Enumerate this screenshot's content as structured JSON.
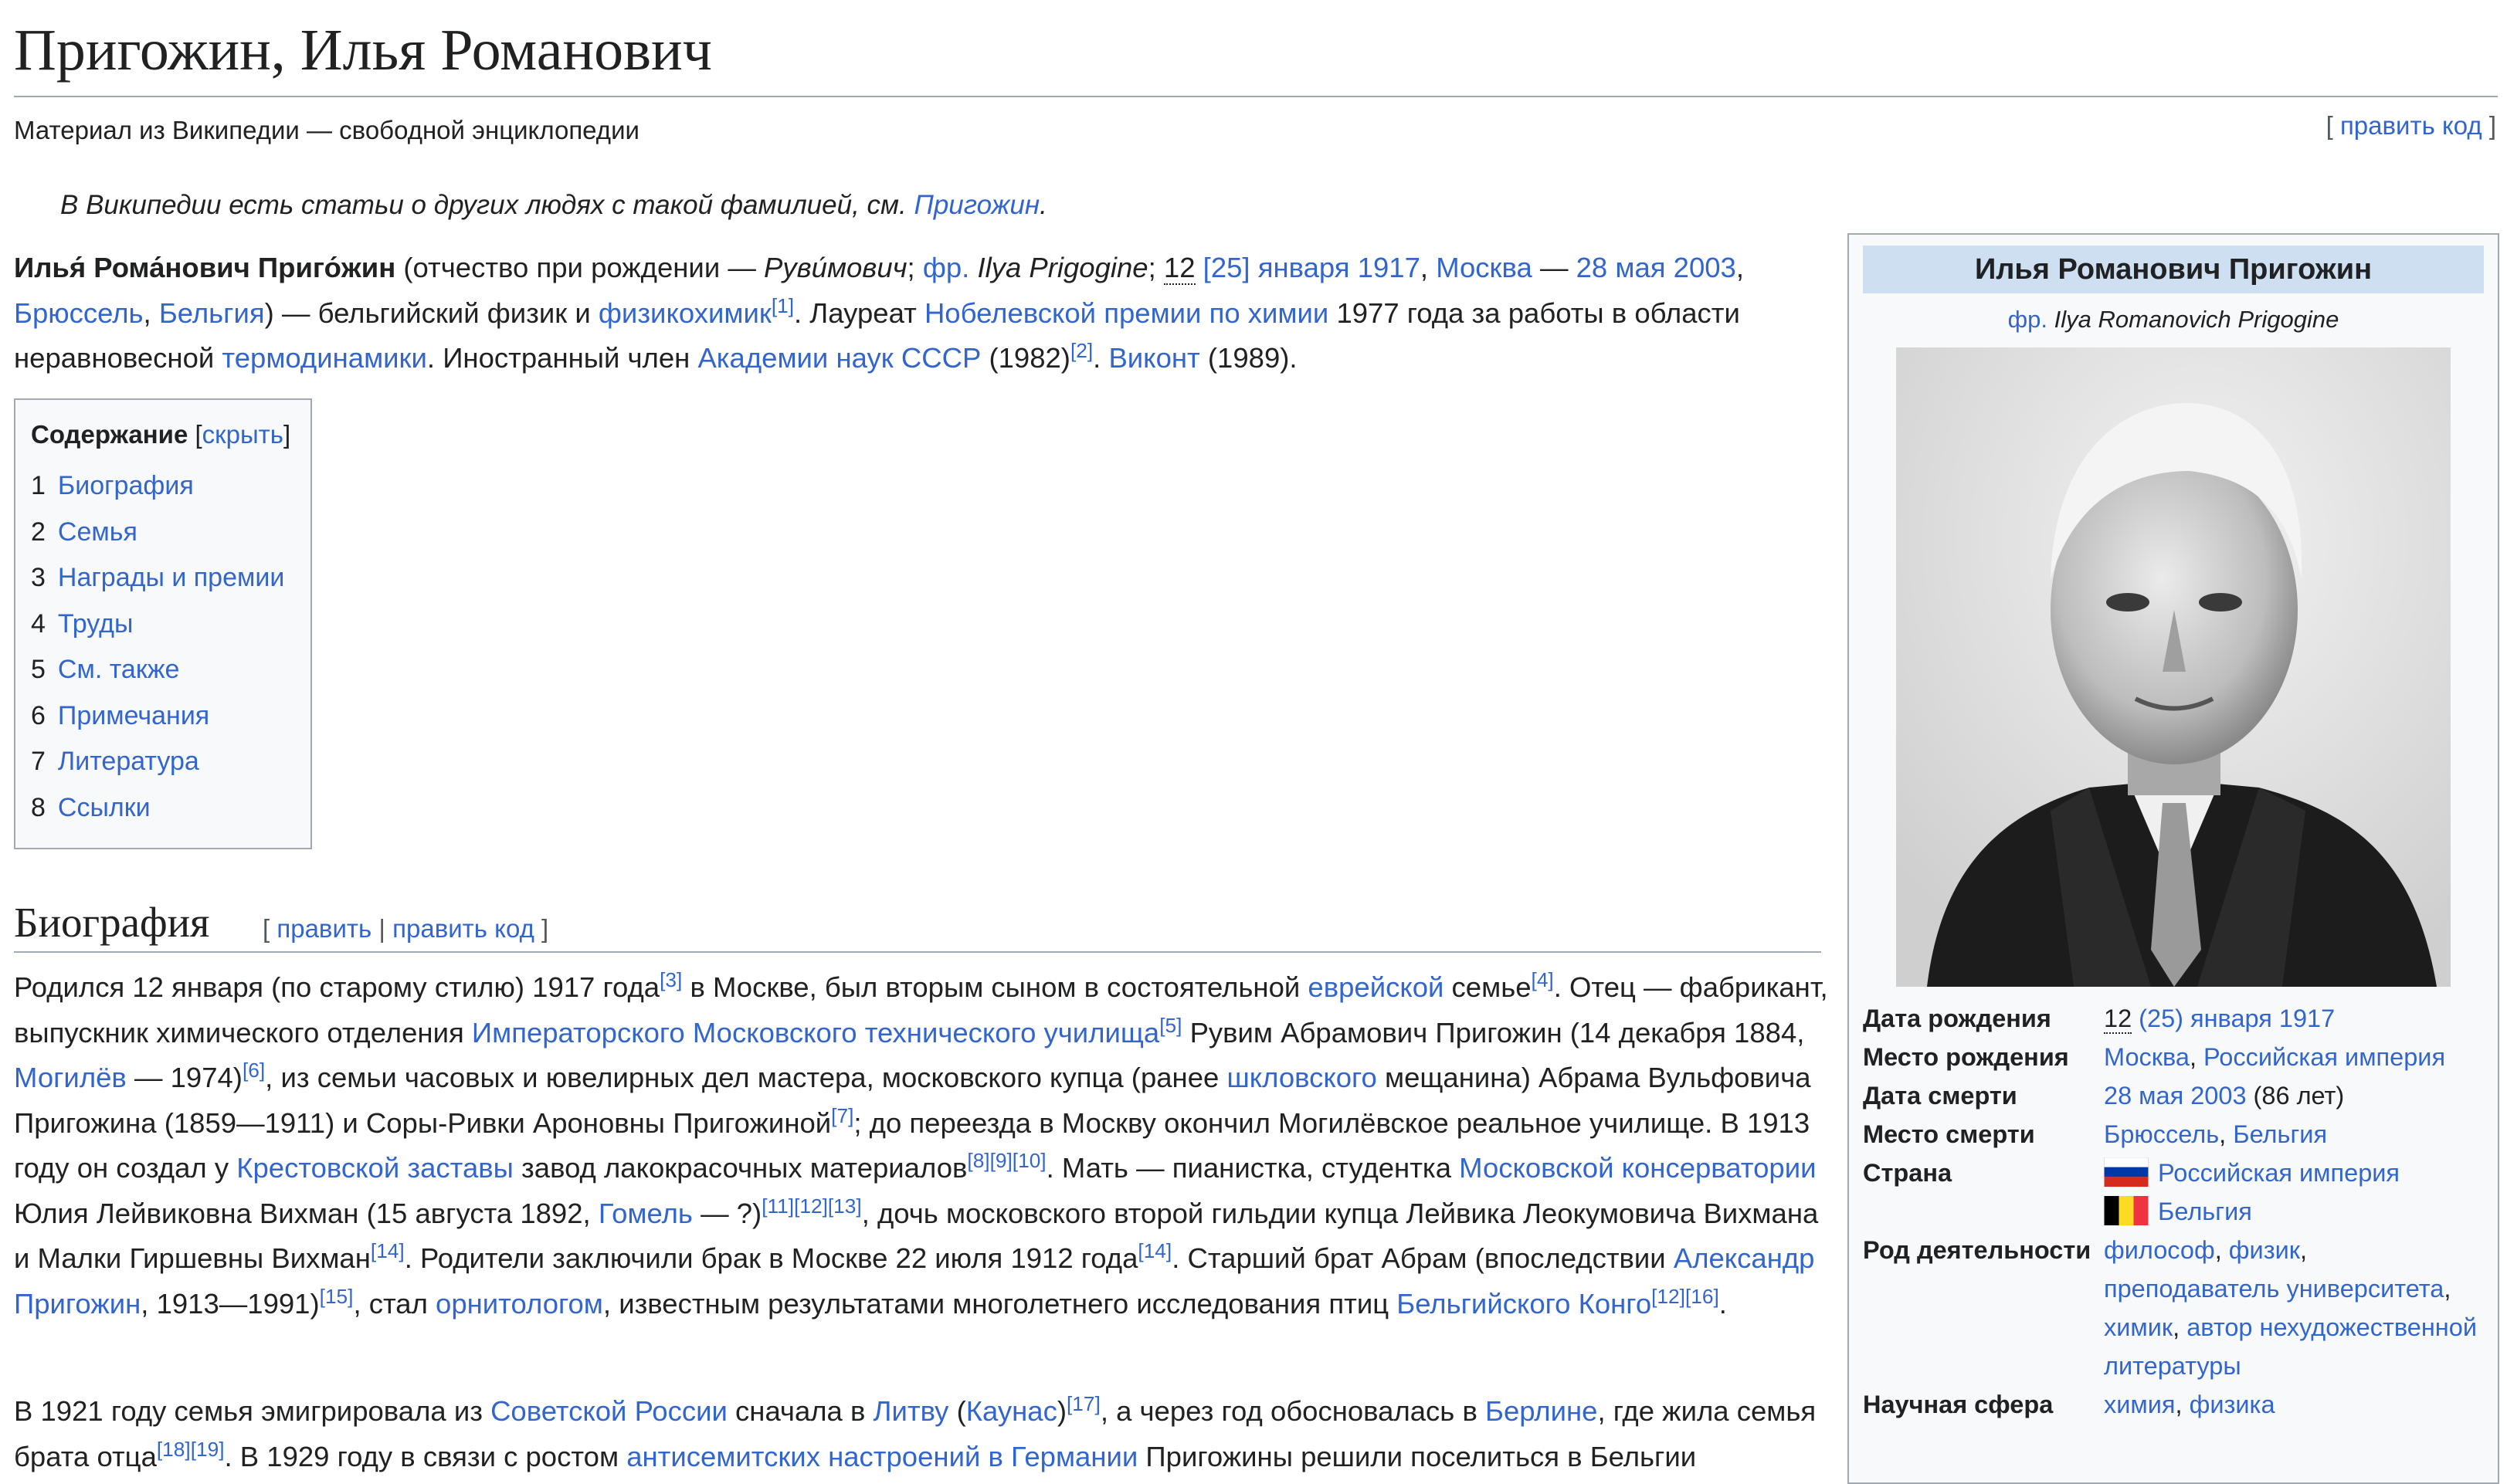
{
  "article": {
    "title": "Пригожин, Илья Романович",
    "tagline": "Материал из Википедии — свободной энциклопедии",
    "edit_source": "править код"
  },
  "hatnote": {
    "text": "В Википедии есть статьи о других людях с такой фамилией, см. ",
    "link": "Пригожин",
    "end": "."
  },
  "lead": {
    "name": "Илья́ Рома́нович Приго́жин",
    "t1": " (отчество при рождении — ",
    "patronymic": "Руви́мович",
    "t2": "; ",
    "lang": "фр.",
    "t3": " Ilya Prigogine",
    "t4": "; ",
    "old_day": "12",
    "t5": " ",
    "birth_link": "[25] января 1917",
    "t6": ", ",
    "city1": "Москва",
    "t7": " — ",
    "death_link": "28 мая 2003",
    "t8": ", ",
    "city2": "Брюссель",
    "t9": ", ",
    "country": "Бельгия",
    "t10": ") — бельгийский физик и ",
    "field": "физикохимик",
    "ref1": "[1]",
    "t11": ". Лауреат ",
    "prize": "Нобелевской премии по химии",
    "t12": " 1977 года за работы в области неравновесной ",
    "thermo": "термодинамики",
    "t13": ". Иностранный член ",
    "academy": "Академии наук СССР",
    "t14": " (1982)",
    "ref2": "[2]",
    "t15": ". ",
    "title_link": "Виконт",
    "t16": " (1989)."
  },
  "toc": {
    "heading": "Содержание",
    "toggle_open": " [",
    "toggle": "скрыть",
    "toggle_close": "]",
    "items": [
      {
        "num": "1",
        "label": "Биография"
      },
      {
        "num": "2",
        "label": "Семья"
      },
      {
        "num": "3",
        "label": "Награды и премии"
      },
      {
        "num": "4",
        "label": "Труды"
      },
      {
        "num": "5",
        "label": "См. также"
      },
      {
        "num": "6",
        "label": "Примечания"
      },
      {
        "num": "7",
        "label": "Литература"
      },
      {
        "num": "8",
        "label": "Ссылки"
      }
    ]
  },
  "section": {
    "heading": "Биография",
    "edit_open": "[ ",
    "edit": "править",
    "edit_sep": " | ",
    "edit_source": "править код",
    "edit_close": " ]"
  },
  "bio1": {
    "a1": "Родился 12 января (по старому стилю) 1917 года",
    "r3": "[3]",
    "a2": " в Москве, был вторым сыном в состоятельной ",
    "l_jewish": "еврейской",
    "a3": " семье",
    "r4": "[4]",
    "a4": ". Отец — фабрикант, выпускник химического отделения ",
    "l_school": "Императорского Московского технического училища",
    "r5": "[5]",
    "a5": " Рувим Абрамович Пригожин (14 декабря 1884, ",
    "l_mogilev": "Могилёв",
    "a6": " — 1974)",
    "r6": "[6]",
    "a7": ", из семьи часовых и ювелирных дел мастера, московского купца (ранее ",
    "l_shklov": "шкловского",
    "a8": " мещанина) Абрама Вульфовича Пригожина (1859—1911) и Соры-Ривки Ароновны Пригожиной",
    "r7": "[7]",
    "a9": "; до переезда в Москву окончил Могилёвское реальное училище. В 1913 году он создал у ",
    "l_zastava": "Крестовской заставы",
    "a10": " завод лакокрасочных материалов",
    "r8": "[8]",
    "r9": "[9]",
    "r10": "[10]",
    "a11": ". Мать — пианистка, студентка ",
    "l_conserv": "Московской консерватории",
    "a12": " Юлия Лейвиковна Вихман (15 августа 1892, ",
    "l_gomel": "Гомель",
    "a13": " — ?)",
    "r11": "[11]",
    "r12": "[12]",
    "r13": "[13]",
    "a14": ", дочь московского второй гильдии купца Лейвика Леокумовича Вихмана и Малки Гиршевны Вихман",
    "r14": "[14]",
    "a15": ". Родители заключили брак в Москве 22 июля 1912 года",
    "r14b": "[14]",
    "a16": ". Старший брат Абрам (впоследствии ",
    "l_alex": "Александр Пригожин",
    "a17": ", 1913—1991)",
    "r15": "[15]",
    "a18": ", стал ",
    "l_ornith": "орнитологом",
    "a19": ", известным результатами многолетнего исследования птиц ",
    "l_congo": "Бельгийского Конго",
    "r12b": "[12]",
    "r16": "[16]",
    "a20": "."
  },
  "bio2": {
    "b1": "В 1921 году семья эмигрировала из ",
    "l_soviet": "Советской России",
    "b2": " сначала в ",
    "l_lit": "Литву",
    "b3": " (",
    "l_kaunas": "Каунас",
    "b4": ")",
    "r17": "[17]",
    "b5": ", а через год обосновалась в ",
    "l_berlin": "Берлине",
    "b6": ", где жила семья брата отца",
    "r18": "[18]",
    "r19": "[19]",
    "b7": ". В 1929 году в связи с ростом ",
    "l_antisem": "антисемитских настроений в Германии",
    "b8": " Пригожины решили поселиться в Бельгии"
  },
  "infobox": {
    "title": "Илья Романович Пригожин",
    "orig_lang": "фр.",
    "orig_name": " Ilya Romanovich Prigogine",
    "rows": {
      "birth_date_key": "Дата рождения",
      "birth_old": "12",
      "birth_link": " (25) января 1917",
      "birth_place_key": "Место рождения",
      "birth_place_1": "Москва",
      "birth_place_sep": ", ",
      "birth_place_2": "Российская империя",
      "death_date_key": "Дата смерти",
      "death_date": "28 мая 2003",
      "death_age": " (86 лет)",
      "death_place_key": "Место смерти",
      "death_place_1": "Брюссель",
      "death_place_sep": ", ",
      "death_place_2": "Бельгия",
      "country_key": "Страна",
      "country_1": "Российская империя",
      "country_2": "Бельгия",
      "occupation_key": "Род деятельности",
      "occ_1": "философ",
      "occ_sep1": ", ",
      "occ_2": "физик",
      "occ_sep2": ",",
      "occ_3": "преподаватель университета",
      "occ_sep3": ",",
      "occ_4": "химик",
      "occ_sep4": ", ",
      "occ_5": "автор нехудожественной литературы",
      "science_key": "Научная сфера",
      "sci_1": "химия",
      "sci_sep": ", ",
      "sci_2": "физика"
    }
  },
  "colors": {
    "link": "#3366cc",
    "text": "#202122",
    "infobox_header": "#cedff2",
    "border": "#a2a9b1"
  }
}
